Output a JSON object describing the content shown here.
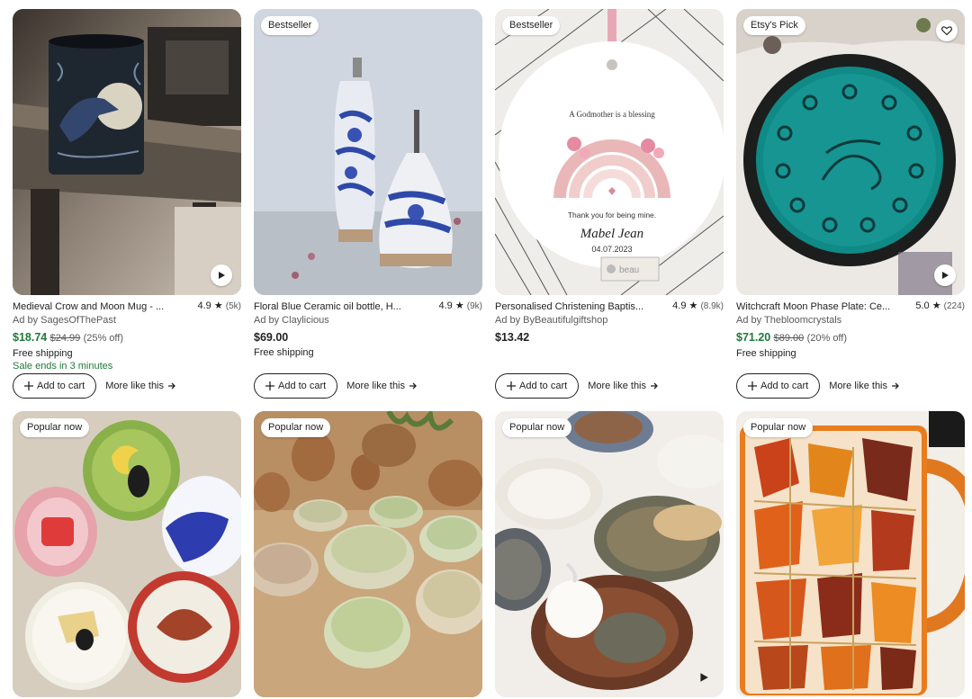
{
  "products": [
    {
      "badge": "",
      "title": "Medieval Crow and Moon Mug - ...",
      "rating": "4.9",
      "reviews": "(5k)",
      "seller": "Ad by SagesOfThePast",
      "price": "$18.74",
      "original_price": "$24.99",
      "discount": "(25% off)",
      "shipping": "Free shipping",
      "sale_note": "Sale ends in 3 minutes",
      "add_to_cart": "Add to cart",
      "more_like_this": "More like this",
      "image_icon": "crow-moon-mug-image"
    },
    {
      "badge": "Bestseller",
      "title": "Floral Blue Ceramic oil bottle, H...",
      "rating": "4.9",
      "reviews": "(9k)",
      "seller": "Ad by Claylicious",
      "price": "$69.00",
      "original_price": "",
      "discount": "",
      "shipping": "Free shipping",
      "sale_note": "",
      "add_to_cart": "Add to cart",
      "more_like_this": "More like this",
      "image_icon": "blue-floral-oil-bottles-image"
    },
    {
      "badge": "Bestseller",
      "title": "Personalised Christening Baptis...",
      "rating": "4.9",
      "reviews": "(8.9k)",
      "seller": "Ad by ByBeautifulgiftshop",
      "price": "$13.42",
      "original_price": "",
      "discount": "",
      "shipping": "",
      "sale_note": "",
      "add_to_cart": "Add to cart",
      "more_like_this": "More like this",
      "image_icon": "rainbow-ornament-image",
      "ornament": {
        "line1": "A Godmother is a blessing",
        "line2": "Thank you for being mine.",
        "name": "Mabel Jean",
        "date": "04.07.2023",
        "watermark": "beau"
      }
    },
    {
      "badge": "Etsy's Pick",
      "title": "Witchcraft Moon Phase Plate: Ce...",
      "rating": "5.0",
      "reviews": "(224)",
      "seller": "Ad by Thebloomcrystals",
      "price": "$71.20",
      "original_price": "$89.00",
      "discount": "(20% off)",
      "shipping": "Free shipping",
      "sale_note": "",
      "add_to_cart": "Add to cart",
      "more_like_this": "More like this",
      "image_icon": "moon-phase-plate-image"
    },
    {
      "badge": "Popular now",
      "image_icon": "painted-cat-plates-image"
    },
    {
      "badge": "Popular now",
      "image_icon": "onyx-bowls-image"
    },
    {
      "badge": "Popular now",
      "image_icon": "garlic-grater-plates-image"
    },
    {
      "badge": "Popular now",
      "image_icon": "autumn-leaves-mug-image"
    }
  ],
  "colors": {
    "sale_green": "#1f7a3a",
    "text": "#222222",
    "muted": "#595959"
  }
}
